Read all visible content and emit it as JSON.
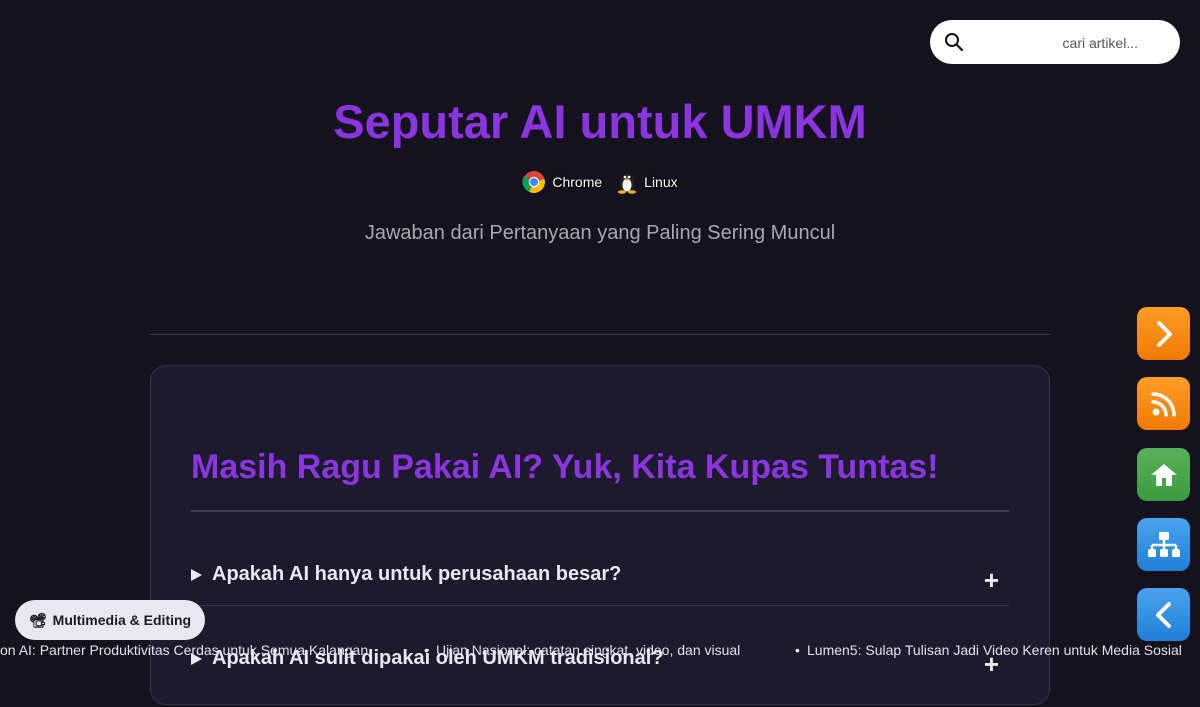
{
  "search": {
    "placeholder": "cari artikel..."
  },
  "header": {
    "title": "Seputar AI untuk UMKM",
    "badges": [
      "Chrome",
      "Linux"
    ],
    "subtitle": "Jawaban dari Pertanyaan yang Paling Sering Muncul"
  },
  "faq_section": {
    "heading": "Masih Ragu Pakai AI? Yuk, Kita Kupas Tuntas!",
    "items": [
      {
        "question": "Apakah AI hanya untuk perusahaan besar?",
        "toggle": "+"
      },
      {
        "question": "Apakah AI sulit dipakai oleh UMKM tradisional?",
        "toggle": "+"
      }
    ]
  },
  "side_buttons": [
    "next-icon",
    "rss-icon",
    "home-icon",
    "sitemap-icon",
    "back-icon"
  ],
  "category_pill": {
    "icon": "📽",
    "label": "Multimedia & Editing"
  },
  "ticker": [
    "on AI: Partner Produktivitas Cerdas untuk Semua Kalangan",
    "Ujian Nasional: catatan singkat, video, dan visual",
    "Lumen5: Sulap Tulisan Jadi Video Keren untuk Media Sosial"
  ],
  "colors": {
    "accent": "#8a35e0",
    "background": "#13121d",
    "card": "#1c1a2c"
  }
}
